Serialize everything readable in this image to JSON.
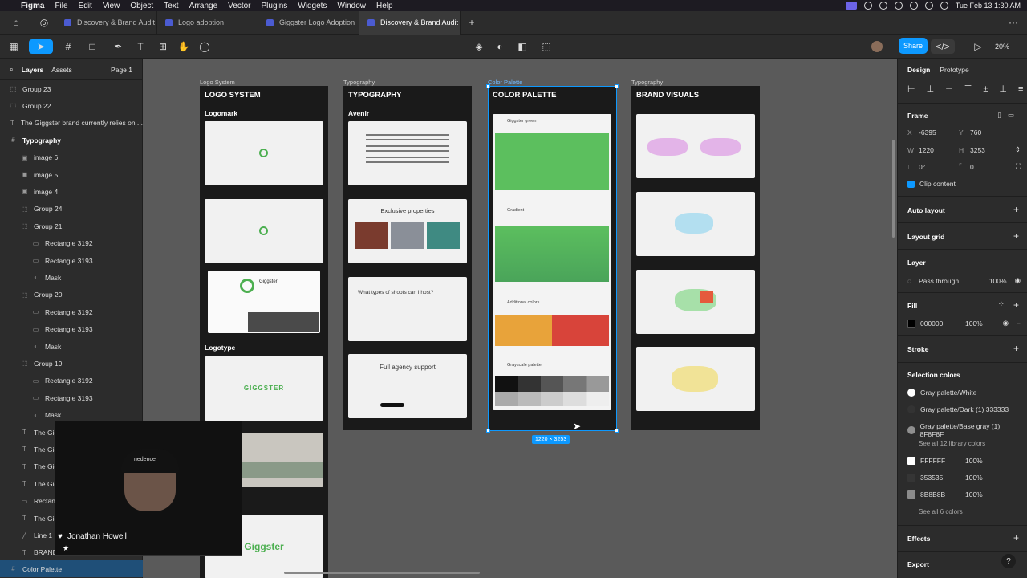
{
  "menubar": {
    "app": "Figma",
    "items": [
      "File",
      "Edit",
      "View",
      "Object",
      "Text",
      "Arrange",
      "Vector",
      "Plugins",
      "Widgets",
      "Window",
      "Help"
    ],
    "clock": "Tue Feb 13  1:30 AM"
  },
  "tabs": [
    {
      "label": "Discovery & Brand Audit",
      "active": false
    },
    {
      "label": "Logo adoption",
      "active": false
    },
    {
      "label": "Giggster Logo Adoption",
      "active": false
    },
    {
      "label": "Discovery & Brand Audit",
      "active": true
    }
  ],
  "toolbar": {
    "share_label": "Share",
    "zoom": "20%"
  },
  "left_panel": {
    "layers_tab": "Layers",
    "assets_tab": "Assets",
    "page": "Page 1",
    "layers": [
      {
        "label": "Group 23",
        "icon": "frame",
        "indent": 0
      },
      {
        "label": "Group 22",
        "icon": "frame",
        "indent": 0
      },
      {
        "label": "The Giggster brand currently relies on ...",
        "icon": "text",
        "indent": 0
      },
      {
        "label": "Typography",
        "icon": "hash",
        "indent": 0,
        "bold": true
      },
      {
        "label": "image 6",
        "icon": "image",
        "indent": 1
      },
      {
        "label": "image 5",
        "icon": "image",
        "indent": 1
      },
      {
        "label": "image 4",
        "icon": "image",
        "indent": 1
      },
      {
        "label": "Group 24",
        "icon": "frame",
        "indent": 1
      },
      {
        "label": "Group 21",
        "icon": "frame",
        "indent": 1
      },
      {
        "label": "Rectangle 3192",
        "icon": "rect",
        "indent": 2
      },
      {
        "label": "Rectangle 3193",
        "icon": "rect",
        "indent": 2
      },
      {
        "label": "Mask",
        "icon": "mask",
        "indent": 2
      },
      {
        "label": "Group 20",
        "icon": "frame",
        "indent": 1
      },
      {
        "label": "Rectangle 3192",
        "icon": "rect",
        "indent": 2
      },
      {
        "label": "Rectangle 3193",
        "icon": "rect",
        "indent": 2
      },
      {
        "label": "Mask",
        "icon": "mask",
        "indent": 2
      },
      {
        "label": "Group 19",
        "icon": "frame",
        "indent": 1
      },
      {
        "label": "Rectangle 3192",
        "icon": "rect",
        "indent": 2
      },
      {
        "label": "Rectangle 3193",
        "icon": "rect",
        "indent": 2
      },
      {
        "label": "Mask",
        "icon": "mask",
        "indent": 2
      },
      {
        "label": "The Gig",
        "icon": "text",
        "indent": 1
      },
      {
        "label": "The Gig",
        "icon": "text",
        "indent": 1
      },
      {
        "label": "The Gig",
        "icon": "text",
        "indent": 1
      },
      {
        "label": "The Gig",
        "icon": "text",
        "indent": 1
      },
      {
        "label": "Rectang",
        "icon": "rect",
        "indent": 1
      },
      {
        "label": "The Gig",
        "icon": "text",
        "indent": 1
      },
      {
        "label": "Line 1",
        "icon": "line",
        "indent": 1
      },
      {
        "label": "BRAND",
        "icon": "text",
        "indent": 1
      }
    ],
    "selected_layer": "Color Palette"
  },
  "canvas": {
    "frames": [
      {
        "label": "Logo System",
        "title": "LOGO SYSTEM"
      },
      {
        "label": "Typography",
        "title": "TYPOGRAPHY"
      },
      {
        "label": "Color Palette",
        "title": "COLOR PALETTE"
      },
      {
        "label": "Typography",
        "title": "BRAND VISUALS"
      }
    ],
    "logo": {
      "logomark": "Logomark",
      "logotype": "Logotype",
      "wordmark": "GIGGSTER",
      "wordmark2": "Giggster",
      "brand_name": "Giggster"
    },
    "typography": {
      "font": "Avenir",
      "sample1": "Exclusive properties",
      "sample2": "What types of shoots can I host?",
      "sample3": "Full agency support"
    },
    "palette": {
      "primary": "Giggster green",
      "gradient": "Gradient",
      "additional": "Additional colors",
      "grayscale": "Grayscale palette",
      "green": "#5cbf5e",
      "green2": "#4aa45a",
      "orange": "#e8a33a",
      "red": "#d8443a"
    },
    "selection_size": "1220 × 3253"
  },
  "right_panel": {
    "tabs": {
      "design": "Design",
      "prototype": "Prototype"
    },
    "frame_label": "Frame",
    "x_label": "X",
    "x": "-6395",
    "y_label": "Y",
    "y": "760",
    "w_label": "W",
    "w": "1220",
    "h_label": "H",
    "h": "3253",
    "rotation": "0°",
    "radius": "0",
    "clip": "Clip content",
    "auto_layout": "Auto layout",
    "layout_grid": "Layout grid",
    "layer_title": "Layer",
    "blend": "Pass through",
    "opacity": "100%",
    "fill_title": "Fill",
    "fill_hex": "000000",
    "fill_opacity": "100%",
    "stroke": "Stroke",
    "selection_colors": "Selection colors",
    "lib_colors": [
      {
        "name": "Gray palette/White",
        "color": "#ffffff"
      },
      {
        "name": "Gray palette/Dark (1) 333333",
        "color": "#333333"
      },
      {
        "name": "Gray palette/Base gray (1) 8F8F8F",
        "color": "#8f8f8f"
      }
    ],
    "see_lib": "See all 12 library colors",
    "colors": [
      {
        "hex": "FFFFFF",
        "opacity": "100%",
        "color": "#ffffff"
      },
      {
        "hex": "353535",
        "opacity": "100%",
        "color": "#353535"
      },
      {
        "hex": "8B8B8B",
        "opacity": "100%",
        "color": "#8b8b8b"
      }
    ],
    "see_colors": "See all 6 colors",
    "effects": "Effects",
    "export": "Export"
  },
  "webcam": {
    "name": "Jonathan Howell",
    "cap_text": "nedence"
  }
}
